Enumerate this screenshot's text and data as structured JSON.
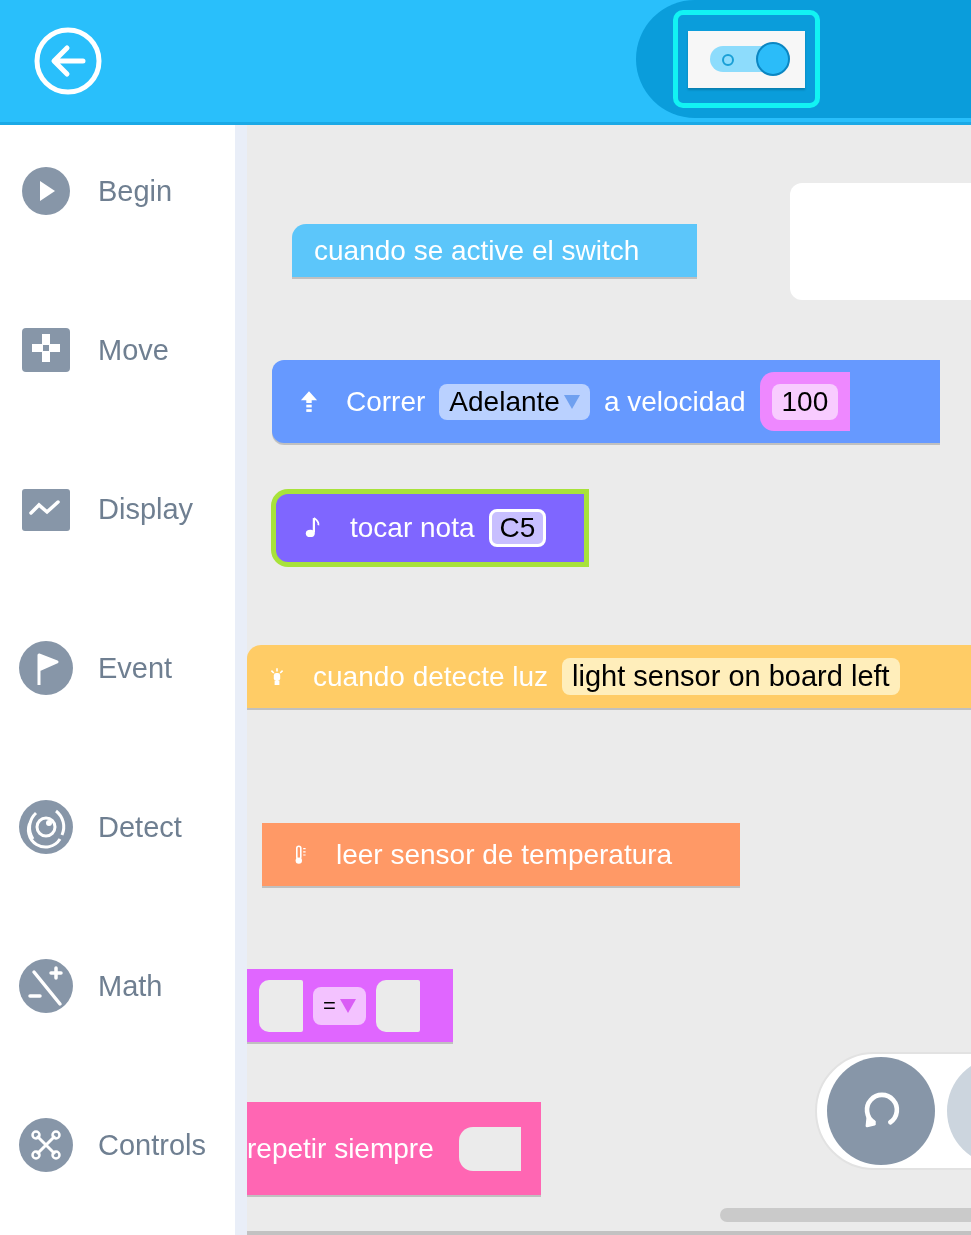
{
  "header": {
    "mode_switch": {
      "on": true
    }
  },
  "sidebar": {
    "items": [
      {
        "label": "Begin"
      },
      {
        "label": "Move"
      },
      {
        "label": "Display"
      },
      {
        "label": "Event"
      },
      {
        "label": "Detect"
      },
      {
        "label": "Math"
      },
      {
        "label": "Controls"
      }
    ]
  },
  "canvas": {
    "blocks": [
      {
        "kind": "hat",
        "color": "#5cc6fa",
        "selected": false,
        "parts": [
          {
            "kind": "label",
            "text": "cuando se active el switch"
          }
        ]
      },
      {
        "kind": "command",
        "color": "#6699ff",
        "selected": false,
        "parts": [
          {
            "kind": "label",
            "text": "Correr"
          },
          {
            "kind": "dropdown",
            "text": "Adelante"
          },
          {
            "kind": "label",
            "text": "a velocidad"
          },
          {
            "kind": "number",
            "text": "100"
          }
        ]
      },
      {
        "kind": "command",
        "color": "#7f66ff",
        "selected": true,
        "parts": [
          {
            "kind": "label",
            "text": "tocar nota"
          },
          {
            "kind": "value",
            "text": "C5"
          }
        ]
      },
      {
        "kind": "hat",
        "color": "#ffcc66",
        "selected": false,
        "parts": [
          {
            "kind": "label",
            "text": "cuando detecte luz"
          },
          {
            "kind": "dropdown",
            "text": "light sensor on board left"
          }
        ]
      },
      {
        "kind": "reporter",
        "color": "#ff9966",
        "selected": false,
        "parts": [
          {
            "kind": "label",
            "text": "leer sensor de temperatura"
          }
        ]
      },
      {
        "kind": "boolean",
        "color": "#e066ff",
        "selected": false,
        "parts": [
          {
            "kind": "slot"
          },
          {
            "kind": "dropdown",
            "text": "="
          },
          {
            "kind": "slot"
          }
        ]
      },
      {
        "kind": "loop",
        "color": "#ff66b3",
        "selected": false,
        "parts": [
          {
            "kind": "label",
            "text": "repetir siempre"
          }
        ]
      }
    ]
  }
}
